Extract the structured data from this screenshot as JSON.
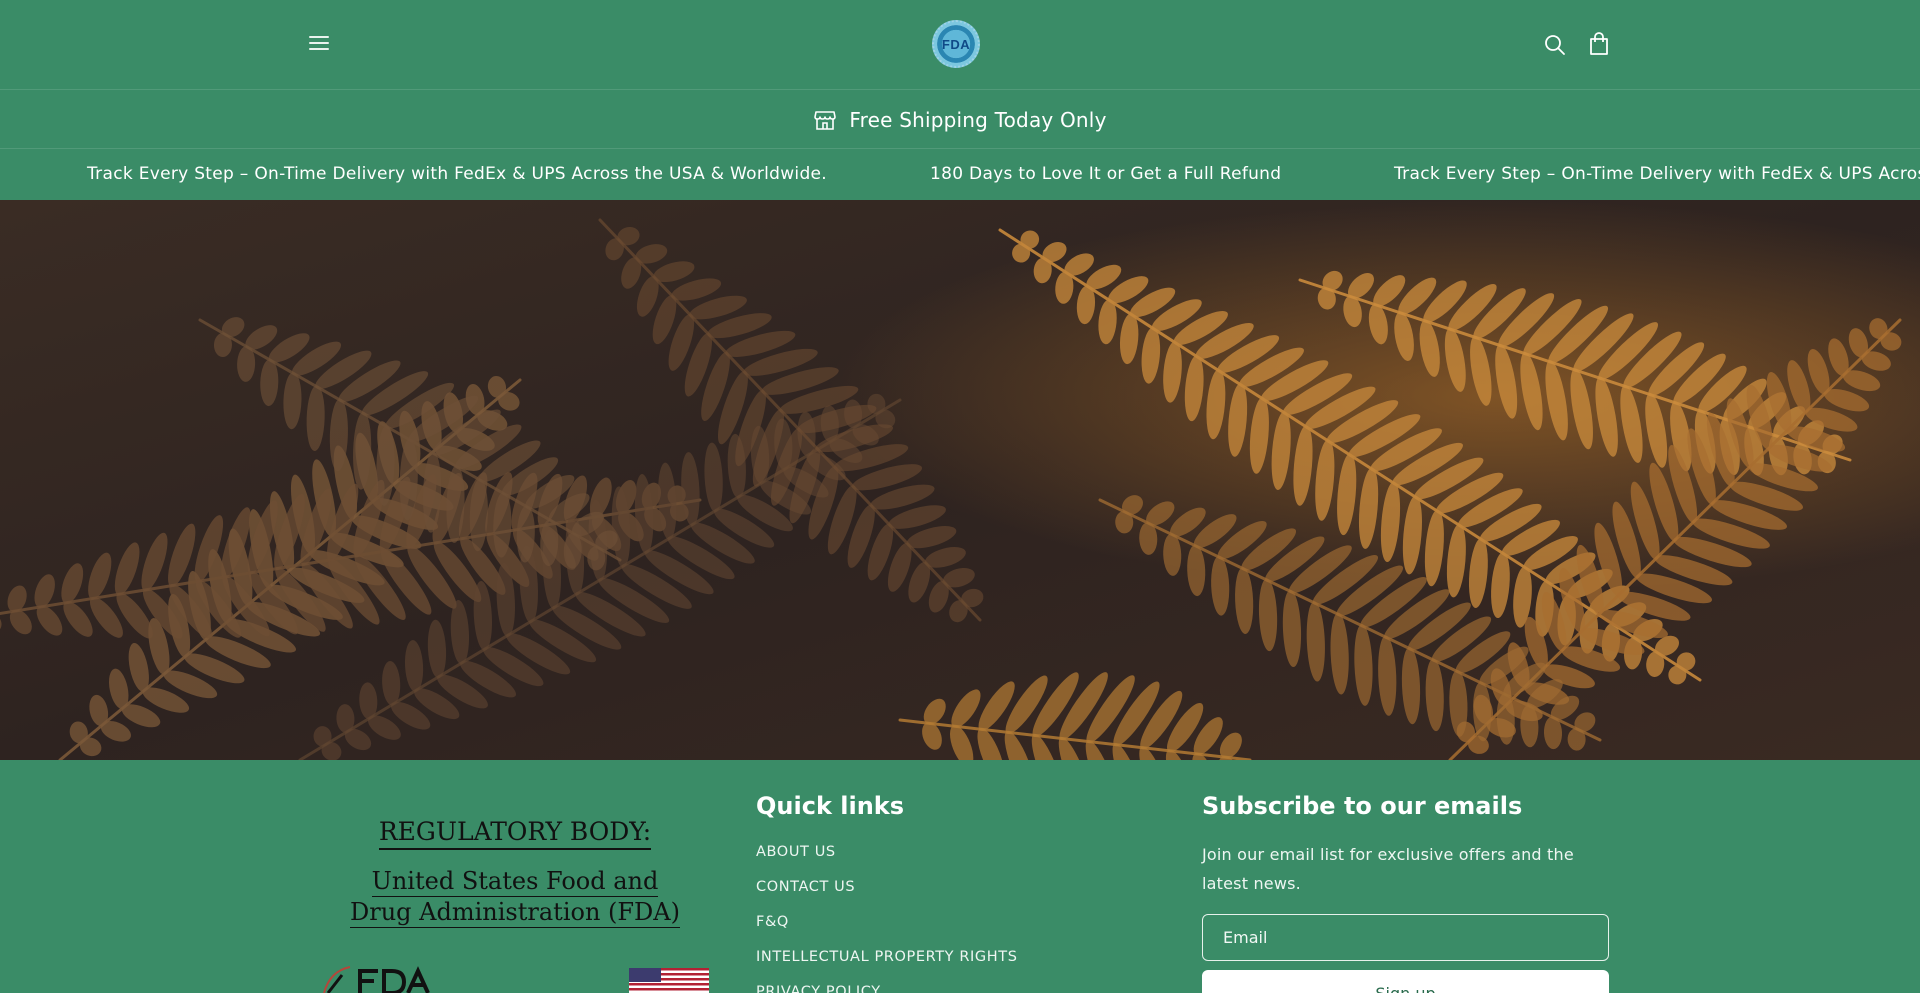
{
  "colors": {
    "header_bg": "#3a8c67",
    "footer_bg": "#3a8c67",
    "text": "#ffffff",
    "regulatory_text": "#111111"
  },
  "header": {
    "menu_icon": "hamburger-icon",
    "logo_text": "FDA",
    "search_icon": "search-icon",
    "cart_icon": "shopping-bag-icon"
  },
  "announcement": {
    "icon": "store-icon",
    "text": "Free Shipping Today Only"
  },
  "marquee": {
    "items": [
      "Track Every Step – On-Time Delivery with FedEx & UPS Across the USA & Worldwide.",
      "180 Days to Love It or Get a Full Refund",
      "Track Every Step – On-Time Delivery with FedEx & UPS Across the USA & Worldwide."
    ]
  },
  "hero": {
    "image": "autumn-fern-leaves"
  },
  "footer": {
    "regulatory": {
      "title": "REGULATORY BODY:",
      "line1": "United States Food and",
      "line2": "Drug Administration (FDA)"
    },
    "quick_links": {
      "title": "Quick links",
      "items": [
        "ABOUT US",
        "CONTACT US",
        "F&Q",
        "INTELLECTUAL PROPERTY RIGHTS",
        "PRIVACY POLICY"
      ]
    },
    "subscribe": {
      "title": "Subscribe to our emails",
      "description": "Join our email list for exclusive offers and the latest news.",
      "email_placeholder": "Email",
      "button_label": "Sign up"
    }
  }
}
